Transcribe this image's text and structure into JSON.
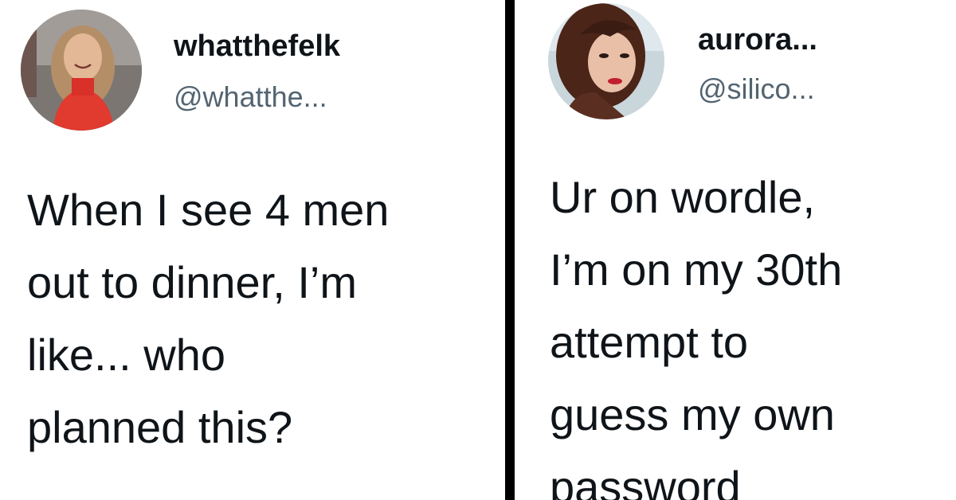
{
  "tweets": [
    {
      "avatar_icon": "profile-photo-woman-red-sweater",
      "display_name": "whatthefelk",
      "handle": "@whatthe...",
      "text_lines": [
        "When I see 4 men",
        "out to dinner, I’m",
        "like... who",
        "planned this?"
      ]
    },
    {
      "avatar_icon": "profile-photo-woman-red-lips",
      "display_name": "aurora...",
      "handle": "@silico...",
      "text_lines": [
        "Ur on wordle,",
        "I’m on my 30th",
        "attempt to",
        "guess my own",
        "password"
      ]
    }
  ],
  "colors": {
    "text_primary": "#0f1419",
    "text_secondary": "#536471",
    "divider": "#000000",
    "background": "#ffffff"
  }
}
